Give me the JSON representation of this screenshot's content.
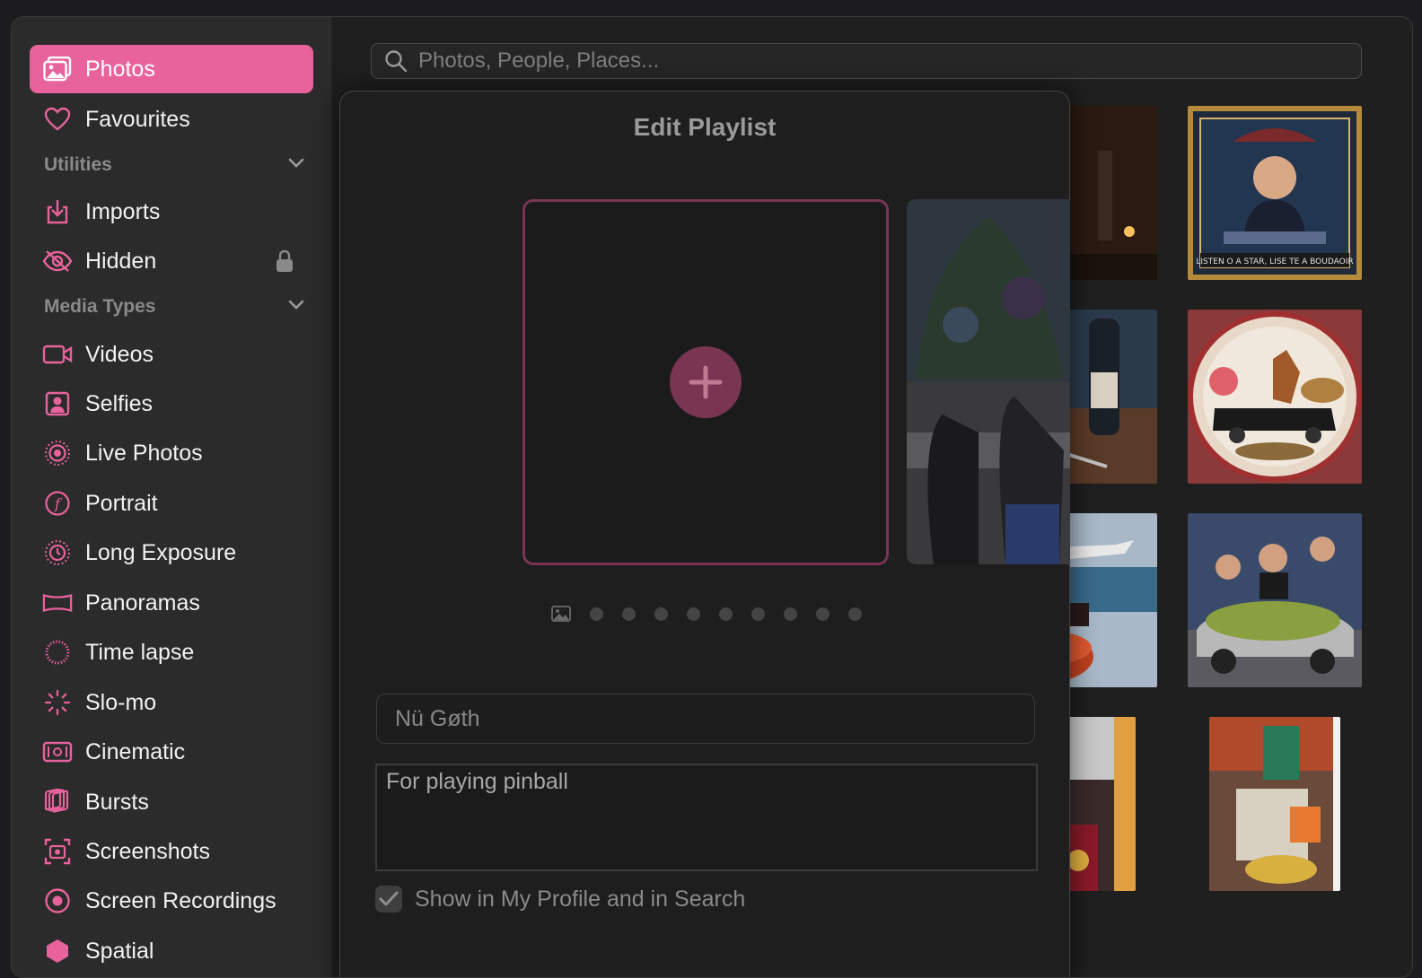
{
  "search": {
    "placeholder": "Photos, People, Places..."
  },
  "sidebar": {
    "items": [
      {
        "label": "Photos",
        "icon": "photos-icon",
        "active": true
      },
      {
        "label": "Favourites",
        "icon": "heart-icon"
      },
      {
        "label": "Imports",
        "icon": "import-icon"
      },
      {
        "label": "Hidden",
        "icon": "eye-slash-icon",
        "locked": true
      },
      {
        "label": "Videos",
        "icon": "video-icon"
      },
      {
        "label": "Selfies",
        "icon": "selfie-icon"
      },
      {
        "label": "Live Photos",
        "icon": "live-photo-icon"
      },
      {
        "label": "Portrait",
        "icon": "portrait-icon"
      },
      {
        "label": "Long Exposure",
        "icon": "long-exposure-icon"
      },
      {
        "label": "Panoramas",
        "icon": "panorama-icon"
      },
      {
        "label": "Time lapse",
        "icon": "time-lapse-icon"
      },
      {
        "label": "Slo-mo",
        "icon": "slo-mo-icon"
      },
      {
        "label": "Cinematic",
        "icon": "cinematic-icon"
      },
      {
        "label": "Bursts",
        "icon": "bursts-icon"
      },
      {
        "label": "Screenshots",
        "icon": "screenshot-icon"
      },
      {
        "label": "Screen Recordings",
        "icon": "screen-recording-icon"
      },
      {
        "label": "Spatial",
        "icon": "spatial-icon"
      }
    ],
    "sections": [
      {
        "label": "Utilities"
      },
      {
        "label": "Media Types"
      }
    ]
  },
  "modal": {
    "title": "Edit Playlist",
    "name_value": "Nü Gøth",
    "description_value": "For playing pinball",
    "show_in_profile_label": "Show in My Profile and in Search",
    "show_in_profile_checked": true,
    "page_dot_count": 9
  },
  "colors": {
    "accent": "#e8629c",
    "accent_dim": "#7a3552"
  }
}
